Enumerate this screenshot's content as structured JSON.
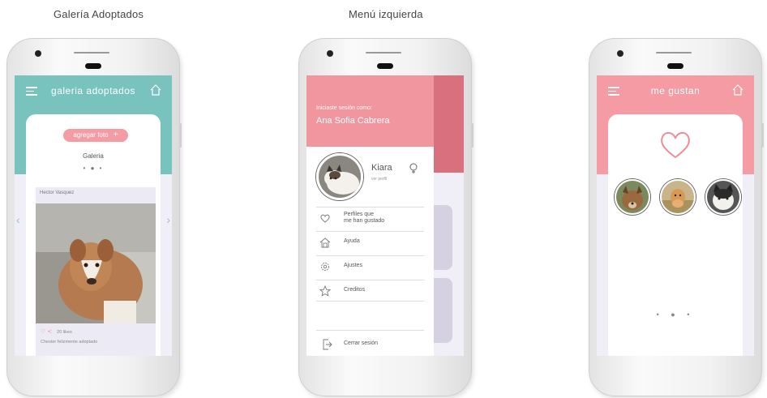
{
  "captions": {
    "left": "Galería Adoptados",
    "middle": "Menú izquierda"
  },
  "gallery": {
    "header_title": "galeria adoptados",
    "add_photo_label": "agregar foto",
    "add_icon": "+",
    "section_label": "Galeria",
    "pager": "• ● •",
    "post": {
      "user": "Hector Vasquez",
      "actions": "♡ ≺",
      "likes": "20 likes",
      "caption": "Chester felizmente adoptado"
    },
    "arrow_left": "‹",
    "arrow_right": "›",
    "accent": "#79c3bf"
  },
  "menu": {
    "logged_in_as": "Iniciaste sesión como:",
    "user_name": "Ana Sofia Cabrera",
    "pet_name": "Kiara",
    "pet_link": "ver perfil",
    "items": [
      {
        "label_1": "Perfiles que",
        "label_2": "me han gustado",
        "icon": "heart-outline-icon"
      },
      {
        "label": "Ayuda",
        "icon": "house-icon"
      },
      {
        "label": "Ajustes",
        "icon": "gear-icon"
      },
      {
        "label": "Creditos",
        "icon": "star-icon"
      }
    ],
    "logout_label": "Cerrar sesión",
    "accent": "#f1959f"
  },
  "likes_screen": {
    "header_title": "me gustan",
    "pager": "• ● •",
    "accent": "#f49ba3"
  }
}
